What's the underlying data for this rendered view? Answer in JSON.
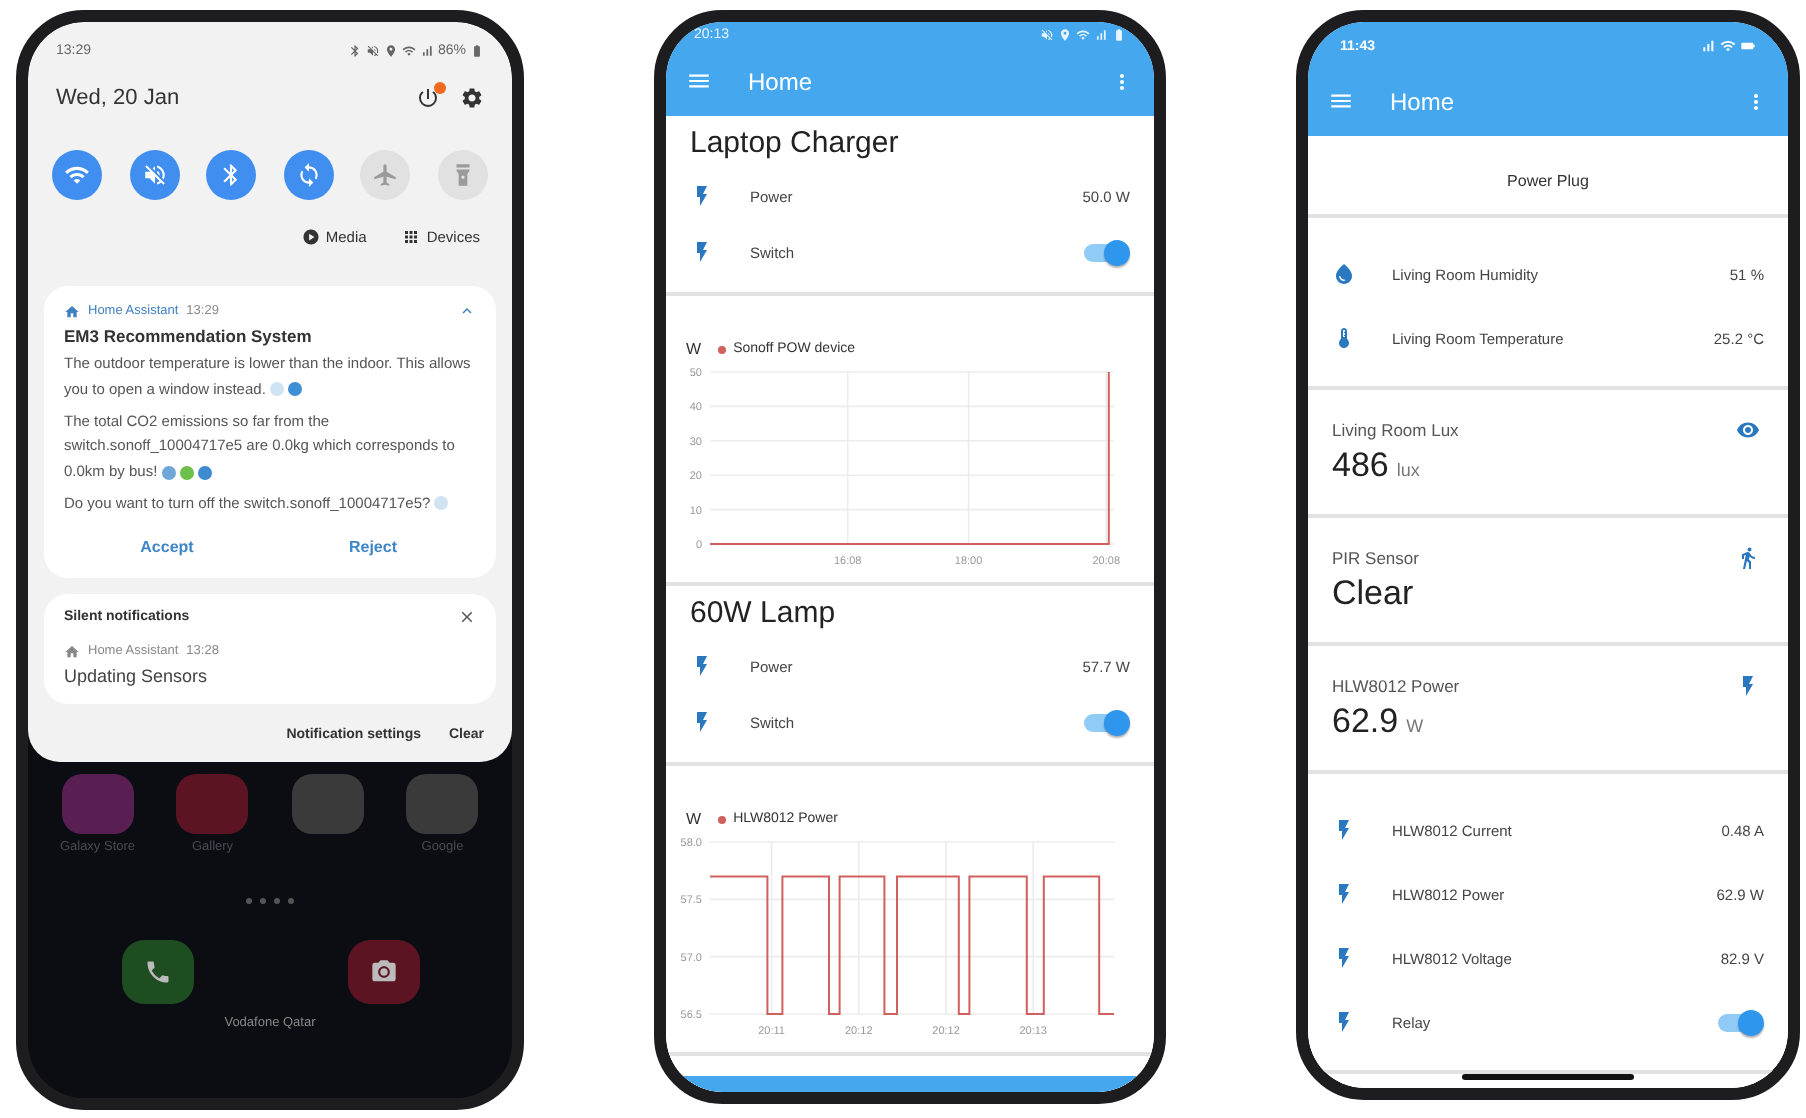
{
  "notification_panel": {
    "status_bar": {
      "time": "13:29",
      "battery": "86%"
    },
    "date": "Wed, 20 Jan",
    "quick_toggles": [
      {
        "kind": "wifi",
        "on": true
      },
      {
        "kind": "mute",
        "on": true
      },
      {
        "kind": "bluetooth",
        "on": true
      },
      {
        "kind": "sync",
        "on": true
      },
      {
        "kind": "airplane",
        "on": false
      },
      {
        "kind": "flashlight",
        "on": false
      }
    ],
    "media_label": "Media",
    "devices_label": "Devices",
    "notification": {
      "app": "Home Assistant",
      "time": "13:29",
      "title": "EM3 Recommendation System",
      "paragraphs": [
        {
          "text": "The outdoor temperature is lower than the indoor. This allows you to open a window instead.",
          "emojis": [
            {
              "color": "#cfe3f2"
            },
            {
              "color": "#3f8fd6"
            }
          ]
        },
        {
          "text": "The total CO2 emissions so far from the switch.sonoff_10004717e5 are 0.0kg which corresponds to 0.0km by bus!",
          "emojis": [
            {
              "color": "#6fa7d8"
            },
            {
              "color": "#6cbf4a"
            },
            {
              "color": "#3d8ad0"
            }
          ]
        },
        {
          "text": "Do you want to turn off the switch.sonoff_10004717e5?",
          "emojis": [
            {
              "color": "#cfe3f2"
            }
          ]
        }
      ],
      "actions": [
        "Accept",
        "Reject"
      ]
    },
    "silent": {
      "header": "Silent notifications",
      "app": "Home Assistant",
      "time": "13:28",
      "text": "Updating Sensors"
    },
    "footer": [
      "Notification settings",
      "Clear"
    ],
    "home_screen": {
      "apps": [
        {
          "label": "Galaxy Store",
          "color": "#5a1f52"
        },
        {
          "label": "Gallery",
          "color": "#5c1422"
        },
        {
          "color": "#3a3a3a"
        },
        {
          "label": "Google",
          "color": "#3a3a3a"
        }
      ],
      "dock": [
        {
          "kind": "phone",
          "color": "#1f4d22"
        },
        {
          "kind": "camera",
          "color": "#5c1422"
        }
      ],
      "carrier": "Vodafone Qatar"
    }
  },
  "energy_dashboard": {
    "status_bar": {
      "time": "20:13"
    },
    "title": "Home",
    "cards": [
      {
        "kind": "entities",
        "title": "Laptop Charger",
        "rows": [
          {
            "kind": "power",
            "name": "Power",
            "value": "50.0 W"
          },
          {
            "kind": "switch",
            "name": "Switch",
            "on": true
          }
        ]
      },
      {
        "kind": "chart",
        "chart_data": {
          "type": "line",
          "grid": true,
          "ylabel": "W",
          "xlim": [
            14.0,
            20.25
          ],
          "ylim": [
            0,
            50
          ],
          "yticks": [
            0,
            10,
            20,
            30,
            40,
            50
          ],
          "xticks": [
            {
              "value": 16.13,
              "label": "16:08"
            },
            {
              "value": 18.0,
              "label": "18:00"
            },
            {
              "value": 20.13,
              "label": "20:08"
            }
          ],
          "series": [
            {
              "name": "Sonoff POW device",
              "color": "#d0605e",
              "x": [
                14.0,
                15.0,
                16.0,
                17.0,
                18.0,
                19.0,
                20.0,
                20.17,
                20.17
              ],
              "values": [
                0,
                0,
                0,
                0,
                0,
                0,
                0,
                0,
                50
              ]
            }
          ]
        }
      },
      {
        "kind": "entities",
        "title": "60W Lamp",
        "rows": [
          {
            "kind": "power",
            "name": "Power",
            "value": "57.7 W"
          },
          {
            "kind": "switch",
            "name": "Switch",
            "on": true
          }
        ]
      },
      {
        "kind": "chart",
        "chart_data": {
          "type": "line",
          "grid": true,
          "ylabel": "W",
          "xlim": [
            20.18161,
            20.22022
          ],
          "ylim": [
            56.5,
            58.0
          ],
          "yticks": [
            {
              "value": 56.5,
              "label": "56.5"
            },
            {
              "value": 57.0,
              "label": "57.0"
            },
            {
              "value": 57.5,
              "label": "57.5"
            },
            {
              "value": 58.0,
              "label": "58.0"
            }
          ],
          "xticks": [
            {
              "value": 20.1875,
              "label": "20:11"
            },
            {
              "value": 20.19583,
              "label": "20:12"
            },
            {
              "value": 20.20417,
              "label": "20:12"
            },
            {
              "value": 20.2125,
              "label": "20:13"
            }
          ],
          "series": [
            {
              "name": "HLW8012 Power",
              "color": "#d0605e",
              "x": [
                20.18161,
                20.18709,
                20.18709,
                20.18852,
                20.18852,
                20.19299,
                20.19299,
                20.194,
                20.194,
                20.19827,
                20.19827,
                20.19949,
                20.19949,
                20.20539,
                20.20539,
                20.2064,
                20.2064,
                20.21189,
                20.21189,
                20.21352,
                20.21352,
                20.2188,
                20.2188,
                20.22022
              ],
              "values": [
                57.7,
                57.7,
                56.5,
                56.5,
                57.7,
                57.7,
                56.5,
                56.5,
                57.7,
                57.7,
                56.5,
                56.5,
                57.7,
                57.7,
                56.5,
                56.5,
                57.7,
                57.7,
                56.5,
                56.5,
                57.7,
                57.7,
                56.5,
                56.5
              ]
            }
          ]
        }
      }
    ]
  },
  "sensor_dashboard": {
    "status_bar": {
      "time": "11:43"
    },
    "title": "Home",
    "plug_label": "Power Plug",
    "cards": [
      {
        "kind": "entities",
        "rows": [
          {
            "kind": "humidity",
            "name": "Living Room Humidity",
            "value": "51 %"
          },
          {
            "kind": "temperature",
            "name": "Living Room Temperature",
            "value": "25.2 °C"
          }
        ]
      },
      {
        "kind": "lux_sensor",
        "name": "Living Room Lux",
        "value": "486",
        "unit": "lux"
      },
      {
        "kind": "motion_sensor",
        "name": "PIR Sensor",
        "value": "Clear"
      },
      {
        "kind": "power_sensor",
        "name": "HLW8012 Power",
        "value": "62.9",
        "unit": "W"
      },
      {
        "kind": "entities",
        "rows": [
          {
            "kind": "power",
            "name": "HLW8012 Current",
            "value": "0.48 A"
          },
          {
            "kind": "power",
            "name": "HLW8012 Power",
            "value": "62.9 W"
          },
          {
            "kind": "power",
            "name": "HLW8012 Voltage",
            "value": "82.9 V"
          },
          {
            "kind": "switch",
            "name": "Relay",
            "on": true
          }
        ]
      }
    ]
  }
}
